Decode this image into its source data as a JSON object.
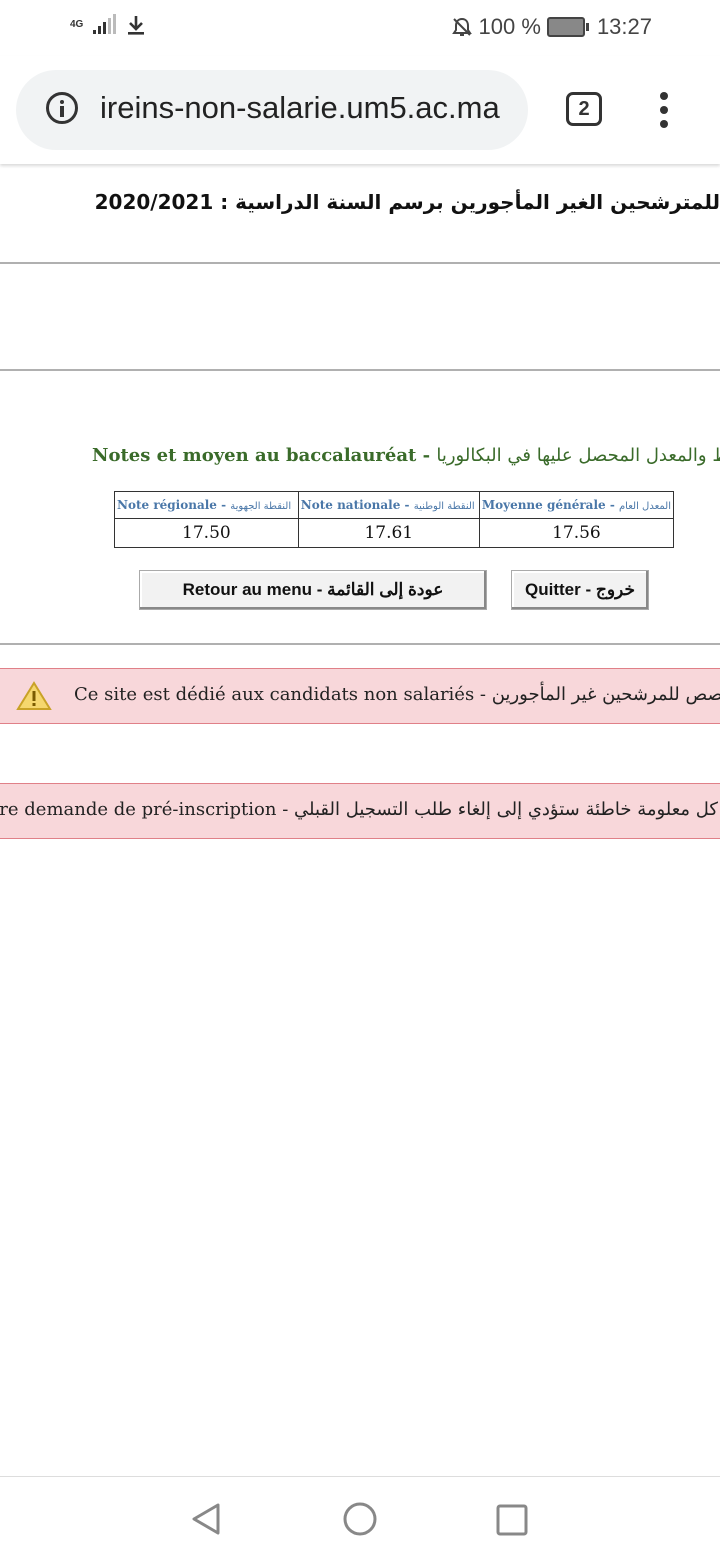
{
  "status_bar": {
    "network": "4G",
    "battery": "100 %",
    "time": "13:27"
  },
  "browser": {
    "url": "ireins-non-salarie.um5.ac.ma",
    "tab_count": "2"
  },
  "page": {
    "title": "للمترشحين الغير المأجورين برسم السنة الدراسية : 2020/2021",
    "notes_title_fr": "Notes et moyen au baccalauréat - ",
    "notes_title_ar": "النقط والمعدل المحصل عليها في البكالوريا",
    "table": {
      "headers": [
        {
          "fr": "Note régionale - ",
          "ar": "النقطة الجهوية"
        },
        {
          "fr": "Note nationale - ",
          "ar": "النقطة الوطنية"
        },
        {
          "fr": "Moyenne générale - ",
          "ar": "المعدل العام"
        }
      ],
      "values": [
        "17.50",
        "17.61",
        "17.56"
      ]
    },
    "buttons": {
      "menu": "Retour au menu - عودة إلى القائمة",
      "quit": "Quitter - خروج"
    },
    "alerts": {
      "dedicated": "Ce site est dédié aux candidats non salariés - الموقع مخصص للمرشحين غير المأجورين",
      "false_info": "Toute fausse information entraînera l’annulation de votre demande de pré-inscription - كل معلومة خاطئة ستؤدي إلى إلغاء طلب التسجيل القبلي"
    }
  }
}
